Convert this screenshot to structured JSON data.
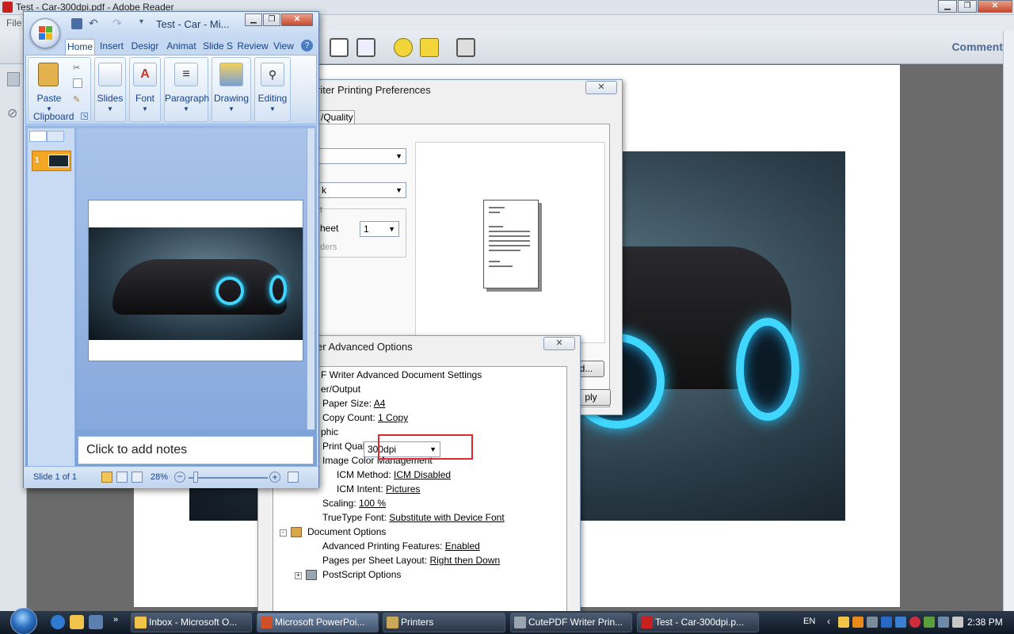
{
  "reader": {
    "title": "Test - Car-300dpi.pdf - Adobe Reader",
    "menu_file": "File",
    "comment_label": "Comment"
  },
  "prefs_dialog": {
    "title": "riter Printing Preferences",
    "tab_label": "/Quality",
    "close_label": "✕",
    "combo2_value": "k",
    "label_section": "t",
    "label_sheet": "heet",
    "sheet_value": "1",
    "label_borders": "ders",
    "advanced_button": "d...",
    "apply_button": "ply"
  },
  "adv_dialog": {
    "title": "er Advanced Options",
    "close_label": "✕",
    "tree": {
      "root": "F Writer Advanced Document Settings",
      "paper_output": "er/Output",
      "paper_size_label": "Paper Size:",
      "paper_size_value": "A4",
      "copy_count_label": "Copy Count:",
      "copy_count_value": "1 Copy",
      "graphic": "phic",
      "print_quality_label": "Print Quality:",
      "print_quality_value": "300dpi",
      "icm_label": "Image Color Management",
      "icm_method_label": "ICM Method:",
      "icm_method_value": "ICM Disabled",
      "icm_intent_label": "ICM Intent:",
      "icm_intent_value": "Pictures",
      "scaling_label": "Scaling:",
      "scaling_value": "100 %",
      "truetype_label": "TrueType Font:",
      "truetype_value": "Substitute with Device Font",
      "doc_options": "Document Options",
      "adv_printing_label": "Advanced Printing Features:",
      "adv_printing_value": "Enabled",
      "pages_per_sheet_label": "Pages per Sheet Layout:",
      "pages_per_sheet_value": "Right then Down",
      "postscript": "PostScript Options"
    }
  },
  "ppt": {
    "title": "Test - Car - Mi...",
    "tabs": [
      "Home",
      "Insert",
      "Desigr",
      "Animat",
      "Slide S",
      "Review",
      "View"
    ],
    "groups": {
      "paste": "Paste",
      "clipboard": "Clipboard",
      "slides": "Slides",
      "font": "Font",
      "paragraph": "Paragraph",
      "drawing": "Drawing",
      "editing": "Editing"
    },
    "slide_number": "1",
    "notes_placeholder": "Click to add notes",
    "status_slide": "Slide 1 of 1",
    "zoom": "28%"
  },
  "taskbar": {
    "buttons": [
      "Inbox - Microsoft O...",
      "Microsoft PowerPoi...",
      "Printers",
      "CutePDF Writer Prin...",
      "Test - Car-300dpi.p..."
    ],
    "lang": "EN",
    "clock": "2:38 PM"
  },
  "colors": {
    "highlight": "#e0282f",
    "neon": "#3fd7ff",
    "office_blue": "#15428b"
  }
}
